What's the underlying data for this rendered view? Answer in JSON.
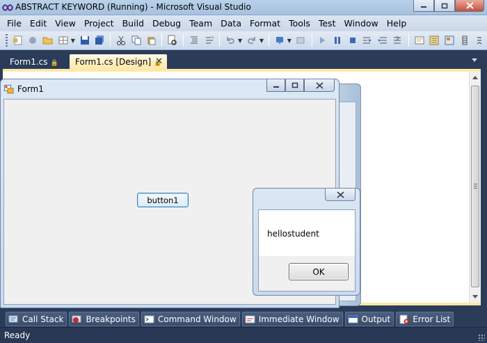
{
  "window": {
    "title": "ABSTRACT KEYWORD (Running) - Microsoft Visual Studio"
  },
  "menu": [
    "File",
    "Edit",
    "View",
    "Project",
    "Build",
    "Debug",
    "Team",
    "Data",
    "Format",
    "Tools",
    "Test",
    "Window",
    "Help"
  ],
  "tabs": {
    "code": "Form1.cs",
    "design": "Form1.cs [Design]"
  },
  "form1": {
    "title": "Form1",
    "button_label": "button1"
  },
  "messagebox": {
    "text": "hellostudent",
    "ok_label": "OK"
  },
  "tool_tabs": [
    "Call Stack",
    "Breakpoints",
    "Command Window",
    "Immediate Window",
    "Output",
    "Error List"
  ],
  "status": {
    "text": "Ready"
  },
  "colors": {
    "chrome": "#2b3c59",
    "active_tab": "#ffe8a6",
    "form_client": "#f0f0f0"
  }
}
